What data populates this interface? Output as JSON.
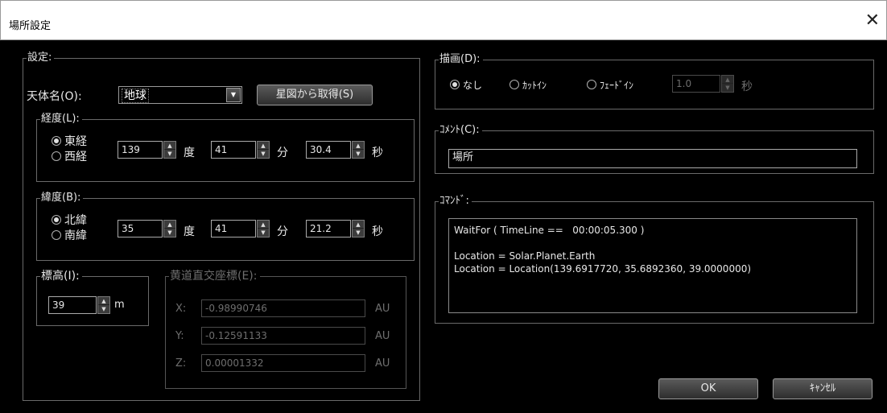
{
  "window": {
    "title": "場所設定",
    "close_glyph": "✕"
  },
  "settings": {
    "legend": "設定:",
    "body_label": "天体名(O):",
    "body_value": "地球",
    "get_from_starmap": "星図から取得(S)",
    "longitude": {
      "legend": "経度(L):",
      "east": "東経",
      "west": "西経",
      "deg": "139",
      "min": "41",
      "sec": "30.4",
      "deg_unit": "度",
      "min_unit": "分",
      "sec_unit": "秒"
    },
    "latitude": {
      "legend": "緯度(B):",
      "north": "北緯",
      "south": "南緯",
      "deg": "35",
      "min": "41",
      "sec": "21.2",
      "deg_unit": "度",
      "min_unit": "分",
      "sec_unit": "秒"
    },
    "altitude": {
      "legend": "標高(I):",
      "value": "39",
      "unit": "m"
    },
    "ecliptic": {
      "legend": "黄道直交座標(E):",
      "x_label": "X:",
      "x_value": "-0.98990746",
      "y_label": "Y:",
      "y_value": "-0.12591133",
      "z_label": "Z:",
      "z_value": "0.00001332",
      "unit": "AU"
    }
  },
  "drawing": {
    "legend": "描画(D):",
    "none": "なし",
    "cutin": "ｶｯﾄｲﾝ",
    "fadein": "ﾌｪｰﾄﾞｲﾝ",
    "duration": "1.0",
    "unit": "秒"
  },
  "comment": {
    "legend": "ｺﾒﾝﾄ(C):",
    "value": "場所"
  },
  "command": {
    "legend": "ｺﾏﾝﾄﾞ:",
    "lines": [
      "WaitFor ( TimeLine ==   00:00:05.300 )",
      "",
      "Location = Solar.Planet.Earth",
      "Location = Location(139.6917720, 35.6892360, 39.0000000)"
    ]
  },
  "buttons": {
    "ok": "OK",
    "cancel": "ｷｬﾝｾﾙ"
  }
}
